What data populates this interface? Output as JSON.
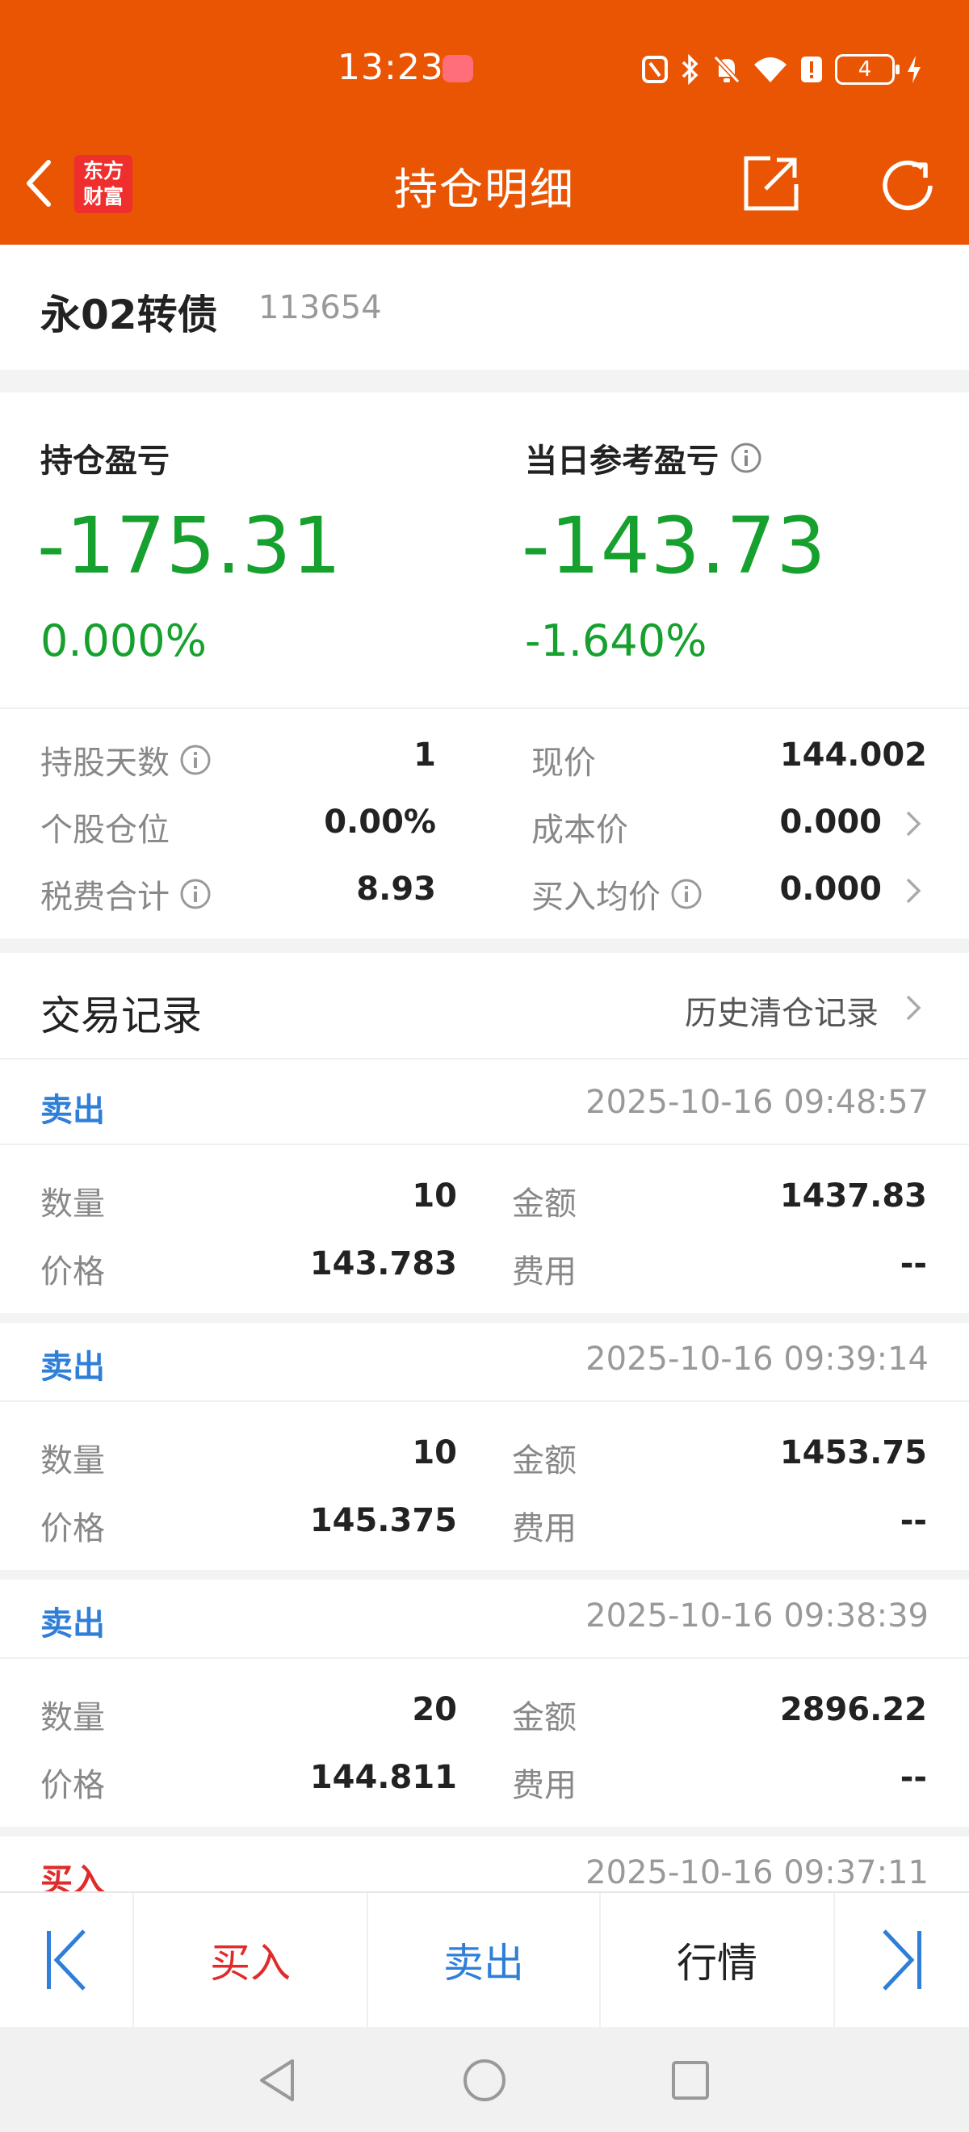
{
  "status_bar": {
    "time": "13:23",
    "battery": "4"
  },
  "nav": {
    "title": "持仓明细",
    "logo_line1": "东方",
    "logo_line2": "财富"
  },
  "stock": {
    "name": "永02转债",
    "code": "113654"
  },
  "summary": {
    "position_pnl_label": "持仓盈亏",
    "position_pnl_value": "-175.31",
    "position_pnl_pct": "0.000%",
    "daily_pnl_label": "当日参考盈亏",
    "daily_pnl_value": "-143.73",
    "daily_pnl_pct": "-1.640%"
  },
  "details": {
    "hold_days_label": "持股天数",
    "hold_days_value": "1",
    "price_label": "现价",
    "price_value": "144.002",
    "position_ratio_label": "个股仓位",
    "position_ratio_value": "0.00%",
    "cost_price_label": "成本价",
    "cost_price_value": "0.000",
    "fees_label": "税费合计",
    "fees_value": "8.93",
    "avg_buy_label": "买入均价",
    "avg_buy_value": "0.000"
  },
  "trades_section": {
    "title": "交易记录",
    "history_link": "历史清仓记录"
  },
  "trade_labels": {
    "qty": "数量",
    "price": "价格",
    "amount": "金额",
    "fee": "费用"
  },
  "trades": [
    {
      "type": "卖出",
      "time": "2025-10-16 09:48:57",
      "qty": "10",
      "price": "143.783",
      "amount": "1437.83",
      "fee": "--"
    },
    {
      "type": "卖出",
      "time": "2025-10-16 09:39:14",
      "qty": "10",
      "price": "145.375",
      "amount": "1453.75",
      "fee": "--"
    },
    {
      "type": "卖出",
      "time": "2025-10-16 09:38:39",
      "qty": "20",
      "price": "144.811",
      "amount": "2896.22",
      "fee": "--"
    },
    {
      "type": "买入",
      "time": "2025-10-16 09:37:11"
    }
  ],
  "bottom_bar": {
    "buy": "买入",
    "sell": "卖出",
    "market": "行情"
  },
  "colors": {
    "header": "#ea5504",
    "loss_green": "#16a02e",
    "sell_blue": "#2f7fd8",
    "buy_red": "#e02b2b"
  }
}
